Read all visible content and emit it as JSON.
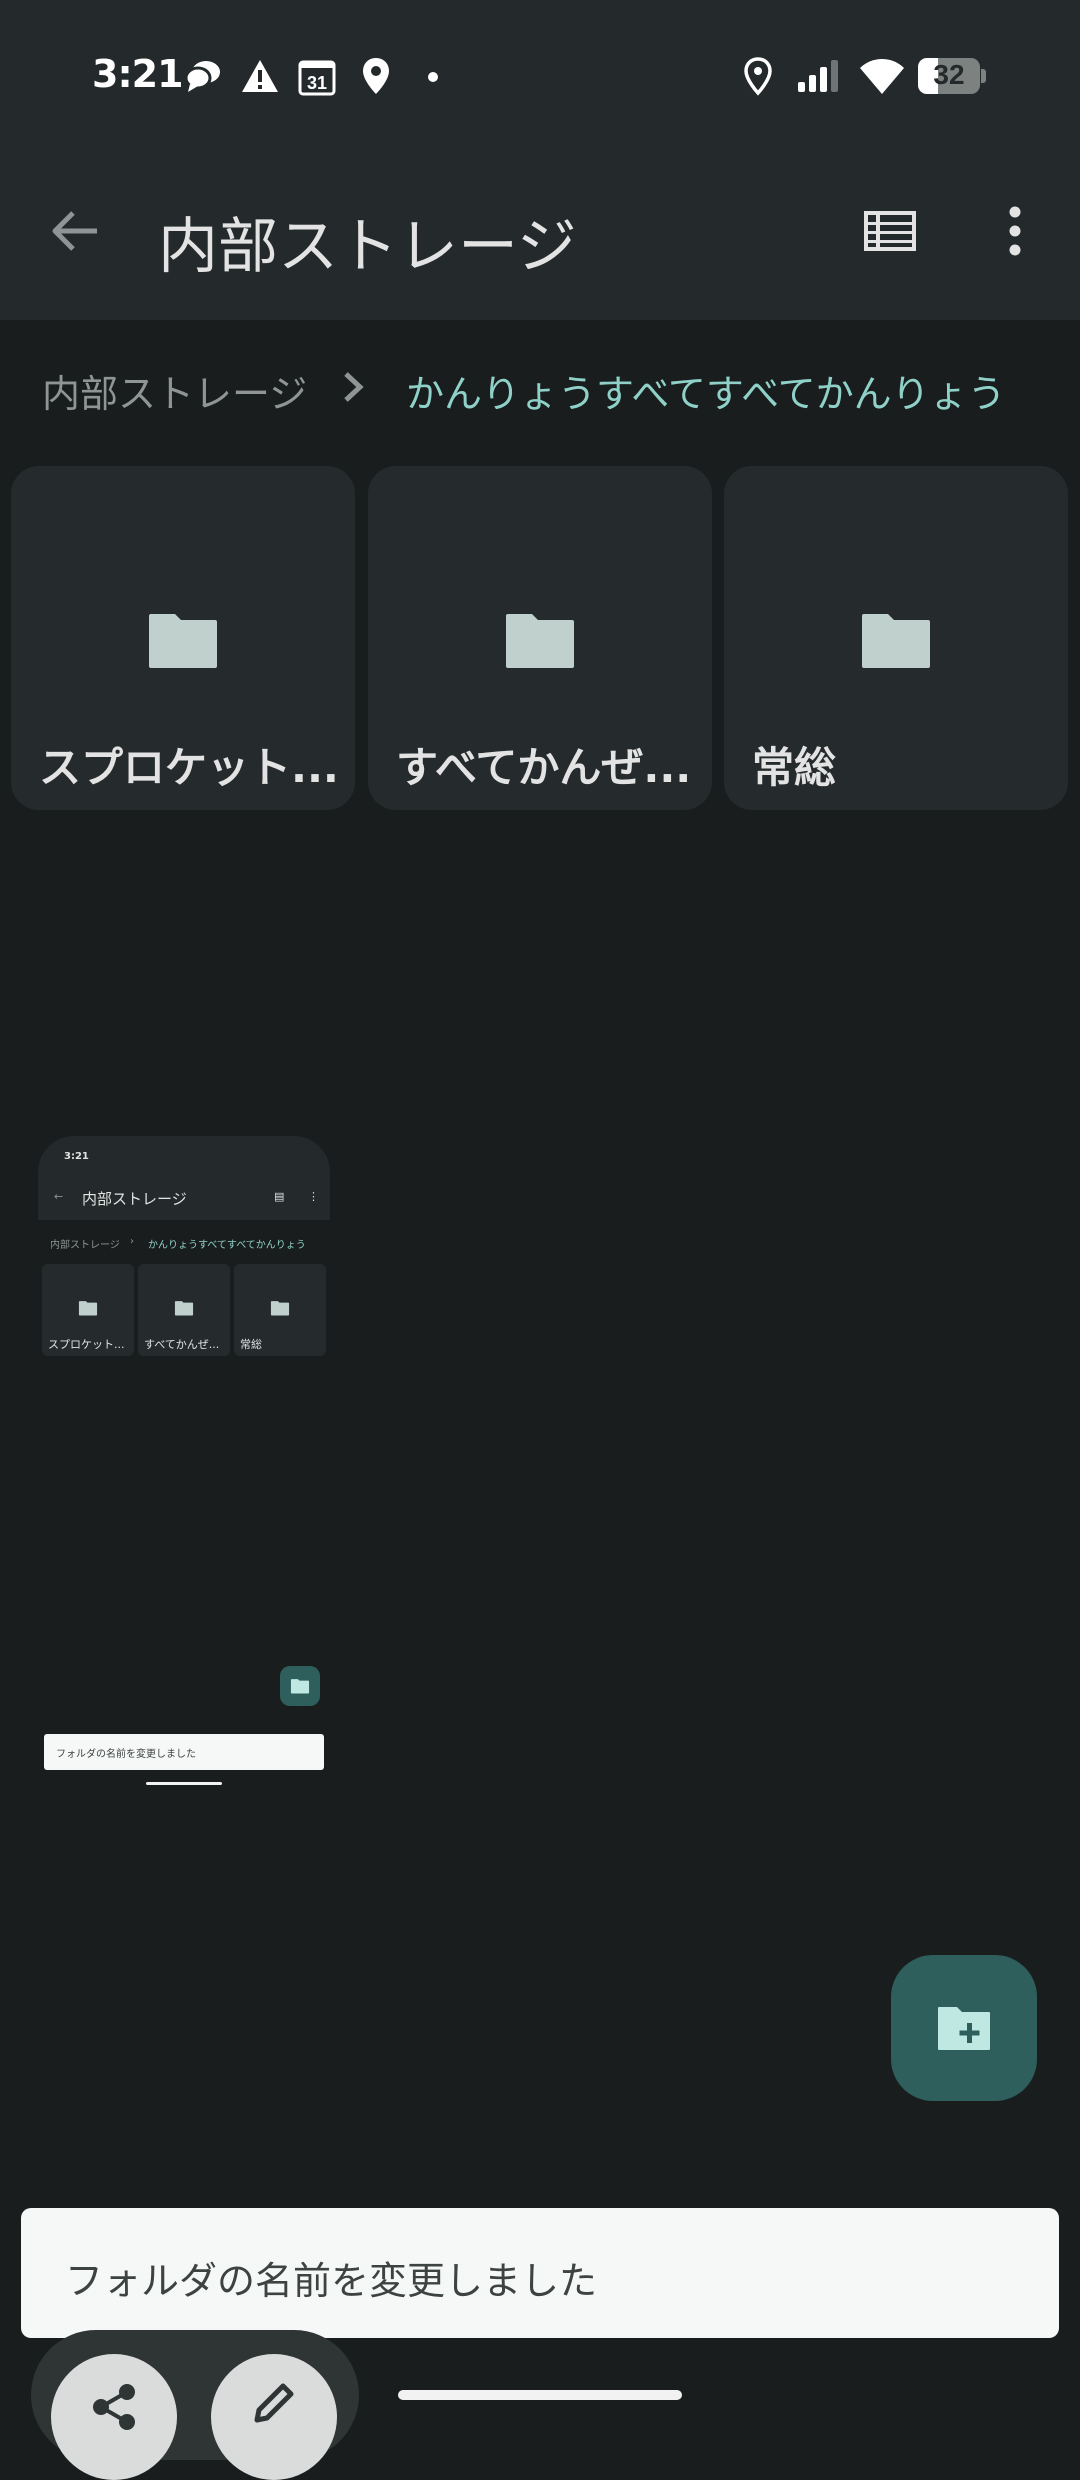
{
  "status_bar": {
    "time": "3:21",
    "calendar_day": "31",
    "battery_level": "32",
    "icons": [
      "chat-icon",
      "warning-icon",
      "calendar-icon",
      "location-icon",
      "dot-icon",
      "location-outline-icon",
      "signal-icon",
      "wifi-icon",
      "battery-icon"
    ]
  },
  "app_bar": {
    "title": "内部ストレージ",
    "back_icon": "arrow-back-icon",
    "view_icon": "list-view-icon",
    "menu_icon": "more-vert-icon"
  },
  "breadcrumb": {
    "root": "内部ストレージ",
    "current": "かんりょうすべてすべてかんりょう"
  },
  "folders": [
    {
      "name": "スプロケット..."
    },
    {
      "name": "すべてかんぜ..."
    },
    {
      "name": "常総"
    }
  ],
  "preview": {
    "time": "3:21",
    "title": "内部ストレージ",
    "crumb_root": "内部ストレージ",
    "crumb_current": "かんりょうすべてすべてかんりょう",
    "folders": [
      "スプロケット...",
      "すべてかんぜ...",
      "常総"
    ],
    "snackbar": "フォルダの名前を変更しました"
  },
  "fab": {
    "icon": "create-new-folder-icon"
  },
  "snackbar": {
    "text": "フォルダの名前を変更しました"
  },
  "bottom_actions": [
    {
      "icon": "share-icon"
    },
    {
      "icon": "edit-icon"
    }
  ],
  "colors": {
    "background": "#191d1d",
    "surface": "#242a2b",
    "accent": "#8fd1c8",
    "fab": "#2f5f5c"
  }
}
